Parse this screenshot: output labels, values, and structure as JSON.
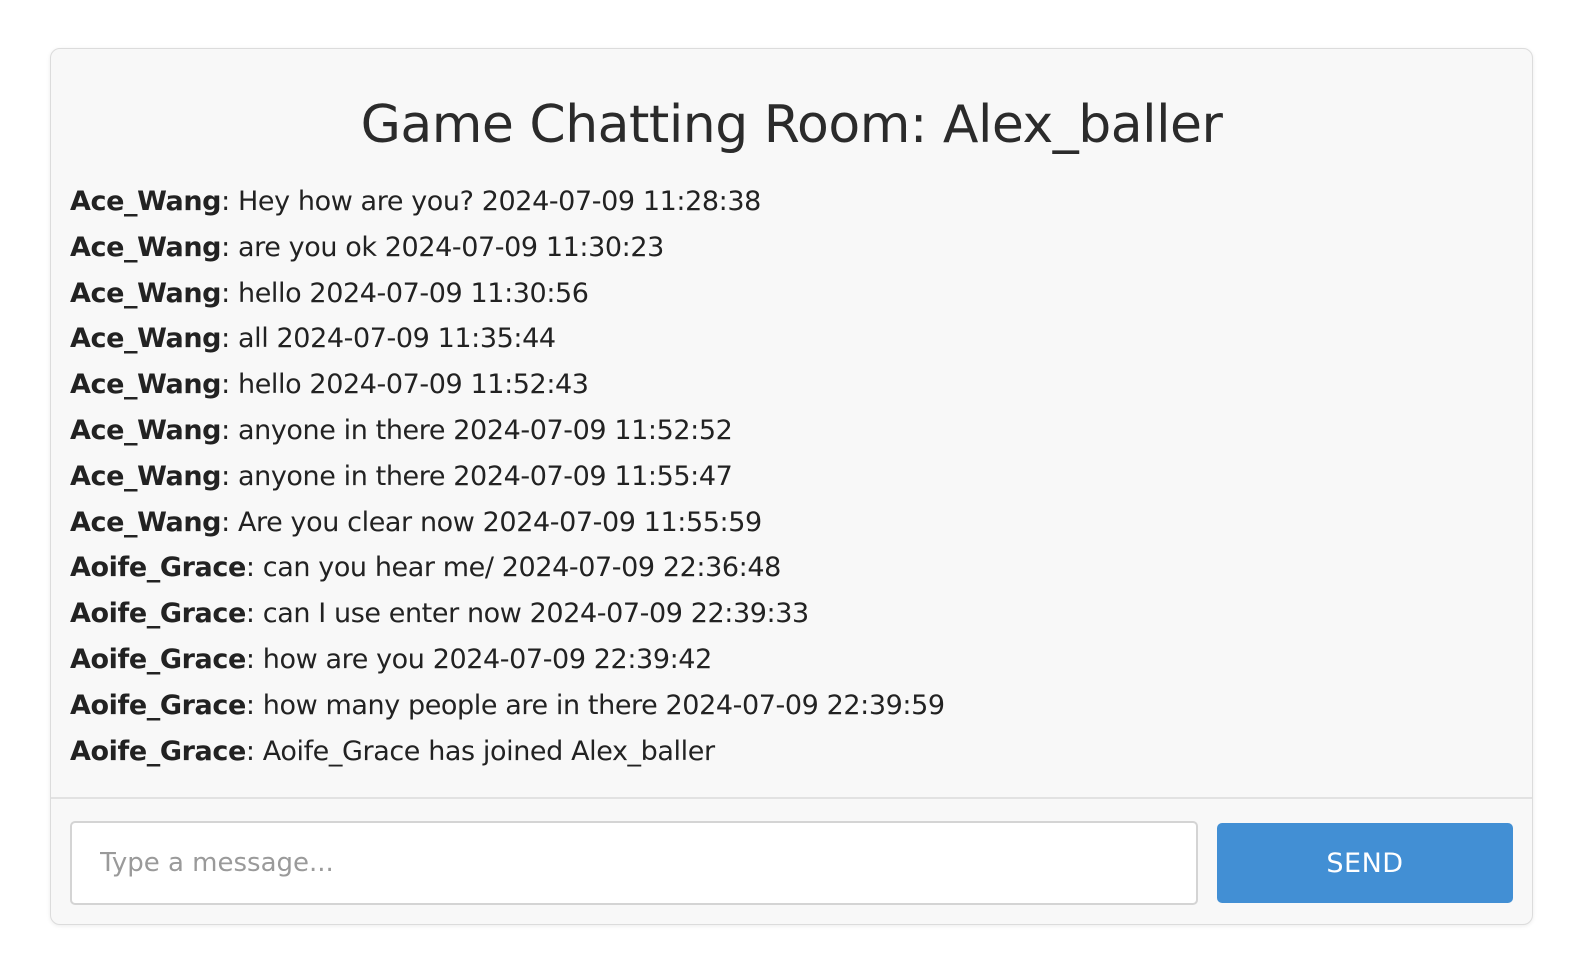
{
  "room": {
    "title": "Game Chatting Room: Alex_baller"
  },
  "messages": [
    {
      "author": "Ace_Wang",
      "text": ": Hey how are you? 2024-07-09 11:28:38"
    },
    {
      "author": "Ace_Wang",
      "text": ": are you ok 2024-07-09 11:30:23"
    },
    {
      "author": "Ace_Wang",
      "text": ": hello 2024-07-09 11:30:56"
    },
    {
      "author": "Ace_Wang",
      "text": ": all 2024-07-09 11:35:44"
    },
    {
      "author": "Ace_Wang",
      "text": ": hello 2024-07-09 11:52:43"
    },
    {
      "author": "Ace_Wang",
      "text": ": anyone in there 2024-07-09 11:52:52"
    },
    {
      "author": "Ace_Wang",
      "text": ": anyone in there 2024-07-09 11:55:47"
    },
    {
      "author": "Ace_Wang",
      "text": ": Are you clear now 2024-07-09 11:55:59"
    },
    {
      "author": "Aoife_Grace",
      "text": ": can you hear me/ 2024-07-09 22:36:48"
    },
    {
      "author": "Aoife_Grace",
      "text": ": can I use enter now 2024-07-09 22:39:33"
    },
    {
      "author": "Aoife_Grace",
      "text": ": how are you 2024-07-09 22:39:42"
    },
    {
      "author": "Aoife_Grace",
      "text": ": how many people are in there 2024-07-09 22:39:59"
    },
    {
      "author": "Aoife_Grace",
      "text": ": Aoife_Grace has joined Alex_baller"
    }
  ],
  "composer": {
    "input_value": "",
    "input_placeholder": "Type a message...",
    "send_label": "SEND"
  },
  "colors": {
    "send_button": "#428fd4",
    "card_background": "#f8f8f8"
  }
}
